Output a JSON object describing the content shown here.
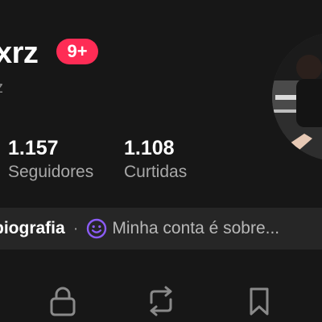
{
  "profile": {
    "username": "xrz",
    "handle": "z",
    "notifications_badge": "9+",
    "avatar": "profile-photo"
  },
  "stats": [
    {
      "value": "1.157",
      "label": "Seguidores"
    },
    {
      "value": "1.108",
      "label": "Curtidas"
    }
  ],
  "bio": {
    "add_label": "biografia",
    "separator": "·",
    "prompt_icon": "smile-icon",
    "prompt_text": "Minha conta é sobre..."
  },
  "tabs": [
    {
      "icon": "lock-icon"
    },
    {
      "icon": "repost-icon"
    },
    {
      "icon": "bookmark-icon"
    }
  ],
  "colors": {
    "background": "#171717",
    "badge": "#fe2c55",
    "bio_bar": "#262626",
    "smile_icon": "#8b5cf6",
    "secondary_text": "#a8a8a8"
  }
}
